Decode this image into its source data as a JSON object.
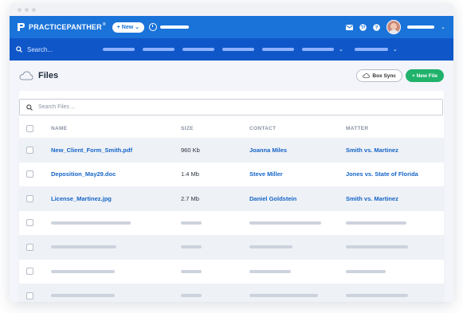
{
  "app": {
    "brand": "PRACTICEPANTHER",
    "brand_mark": "®"
  },
  "topbar": {
    "new_label": "+ New",
    "new_chevron": "⌄",
    "user_chevron": "⌄"
  },
  "navbar": {
    "search_placeholder": "Search..."
  },
  "page": {
    "title": "Files",
    "box_sync_label": "Box Sync",
    "new_file_label": "+ New File"
  },
  "files_search": {
    "placeholder": "Search Files ..."
  },
  "table": {
    "headers": {
      "name": "NAME",
      "size": "SIZE",
      "contact": "CONTACT",
      "matter": "MATTER"
    },
    "rows": [
      {
        "name": "New_Client_Form_Smith.pdf",
        "size": "960 Kb",
        "contact": "Joanna Miles",
        "matter": "Smith vs. Martinez"
      },
      {
        "name": "Deposition_May29.doc",
        "size": "1.4 Mb",
        "contact": "Steve Miller",
        "matter": "Jones vs. State of Florida"
      },
      {
        "name": "License_Martinez.jpg",
        "size": "2.7 Mb",
        "contact": "Daniel Goldstein",
        "matter": "Smith vs. Martinez"
      }
    ]
  },
  "colors": {
    "topbar": "#1a73d9",
    "navbar": "#0f57c9",
    "link": "#1565c8",
    "accent_green": "#20b26b"
  },
  "icons": [
    "logo-mark-icon",
    "timer-icon",
    "mail-icon",
    "globe-icon",
    "help-icon",
    "search-icon",
    "cloud-icon",
    "checkbox-icon"
  ]
}
